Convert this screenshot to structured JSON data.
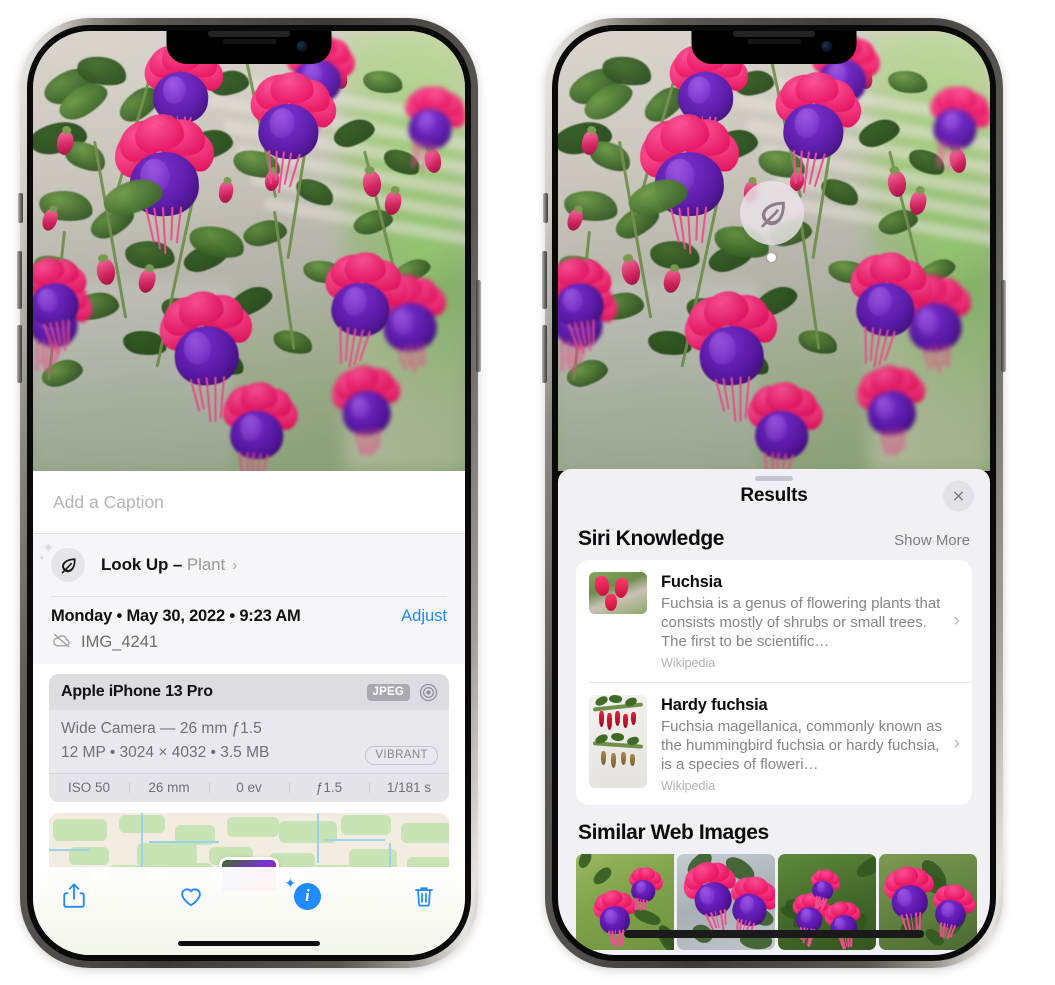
{
  "left_phone": {
    "caption": {
      "placeholder": "Add a Caption",
      "value": ""
    },
    "lookup": {
      "label": "Look Up – ",
      "subject": "Plant",
      "chevron": "›",
      "icon": "leaf-icon"
    },
    "metadata": {
      "date": "Monday • May 30, 2022 • 9:23 AM",
      "adjust_label": "Adjust",
      "filename": "IMG_4241",
      "cloud_icon": "cloud-slash-icon"
    },
    "camera_card": {
      "device": "Apple iPhone 13 Pro",
      "format_badge": "JPEG",
      "aperture_icon": "aperture-icon",
      "lens": "Wide Camera — 26 mm ƒ1.5",
      "specs": "12 MP • 3024 × 4032 • 3.5 MB",
      "style_badge": "VIBRANT",
      "exif": [
        "ISO 50",
        "26 mm",
        "0 ev",
        "ƒ1.5",
        "1/181 s"
      ]
    },
    "toolbar": [
      {
        "name": "share-button",
        "icon": "share-icon"
      },
      {
        "name": "favorite-button",
        "icon": "heart-icon"
      },
      {
        "name": "info-button",
        "icon": "info-sparkle-icon"
      },
      {
        "name": "delete-button",
        "icon": "trash-icon"
      }
    ]
  },
  "right_phone": {
    "visual_lookup_badge": {
      "icon": "leaf-icon"
    },
    "sheet": {
      "title": "Results",
      "close_icon": "close-icon"
    },
    "siri_knowledge": {
      "heading": "Siri Knowledge",
      "show_more": "Show More",
      "entries": [
        {
          "title": "Fuchsia",
          "description": "Fuchsia is a genus of flowering plants that consists mostly of shrubs or small trees. The first to be scientific…",
          "source": "Wikipedia",
          "chevron": "›"
        },
        {
          "title": "Hardy fuchsia",
          "description": "Fuchsia magellanica, commonly known as the hummingbird fuchsia or hardy fuchsia, is a species of floweri…",
          "source": "Wikipedia",
          "chevron": "›"
        }
      ]
    },
    "similar_web_images": {
      "heading": "Similar Web Images",
      "count": 4
    }
  },
  "colors": {
    "accent_blue": "#1f8bff",
    "sheet_bg": "#f1f0f4",
    "card_bg": "#ffffff",
    "secondary_text": "#84848b"
  }
}
